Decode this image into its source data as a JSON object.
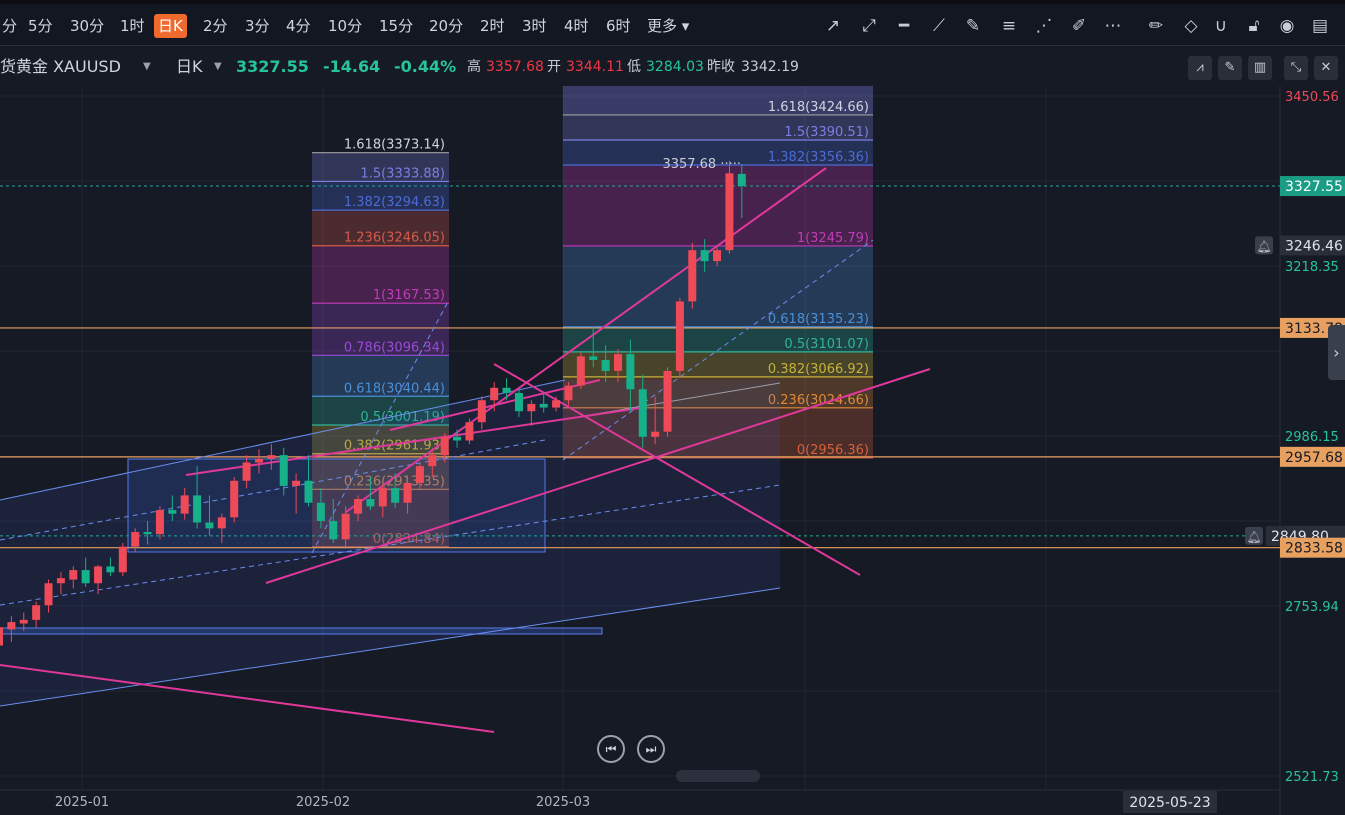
{
  "toolbar": {
    "timeframes": [
      "分",
      "5分",
      "30分",
      "1时",
      "日K",
      "2分",
      "3分",
      "4分",
      "10分",
      "15分",
      "20分",
      "2时",
      "3时",
      "4时",
      "6时",
      "更多"
    ],
    "active_timeframe": "日K"
  },
  "symbol": {
    "name": "货黄金 XAUUSD",
    "interval": "日K",
    "last": "3327.55",
    "change": "-14.64",
    "change_pct": "-0.44%",
    "high_label": "高",
    "high": "3357.68",
    "open_label": "开",
    "open": "3344.11",
    "low_label": "低",
    "low": "3284.03",
    "prev_label": "昨收",
    "prev_close": "3342.19"
  },
  "colors": {
    "up": "#f23645",
    "down": "#089981",
    "accent": "#f06a2e"
  },
  "chart_data": {
    "type": "candlestick",
    "x_ticks": [
      "2025-01",
      "2025-02",
      "2025-03"
    ],
    "crosshair_date": "2025-05-23",
    "price_axis_ticks": [
      "3450.56",
      "3218.35",
      "2986.15",
      "2753.94",
      "2521.73"
    ],
    "price_labels": [
      {
        "value": "3327.55",
        "kind": "last"
      },
      {
        "value": "3246.46",
        "kind": "alert"
      },
      {
        "value": "3133.78",
        "kind": "level"
      },
      {
        "value": "2957.68",
        "kind": "level"
      },
      {
        "value": "2849.80",
        "kind": "alert"
      },
      {
        "value": "2833.58",
        "kind": "level"
      }
    ],
    "high_marker": "3357.68",
    "fib_left": {
      "levels": [
        {
          "label": "1.618(3373.14)",
          "price": 3373.14,
          "color": "#a0a0a0"
        },
        {
          "label": "1.5(3333.88)",
          "price": 3333.88,
          "color": "#7b7fe0"
        },
        {
          "label": "1.382(3294.63)",
          "price": 3294.63,
          "color": "#4c6bd8"
        },
        {
          "label": "1.236(3246.05)",
          "price": 3246.05,
          "color": "#d65a4a"
        },
        {
          "label": "1(3167.53)",
          "price": 3167.53,
          "color": "#c43ab8"
        },
        {
          "label": "0.786(3096.34)",
          "price": 3096.34,
          "color": "#9a4ad8"
        },
        {
          "label": "0.618(3040.44)",
          "price": 3040.44,
          "color": "#4a90d8"
        },
        {
          "label": "0.5(3001.19)",
          "price": 3001.19,
          "color": "#2fb39a"
        },
        {
          "label": "0.382(2961.93)",
          "price": 2961.93,
          "color": "#c8b23a"
        },
        {
          "label": "0.236(2913.35)",
          "price": 2913.35,
          "color": "#e08a3a"
        },
        {
          "label": "0(2834.84)",
          "price": 2834.84,
          "color": "#d8613a"
        }
      ]
    },
    "fib_right": {
      "levels": [
        {
          "label": "1.618(3424.66)",
          "price": 3424.66,
          "color": "#a0a0a0"
        },
        {
          "label": "1.5(3390.51)",
          "price": 3390.51,
          "color": "#7b7fe0"
        },
        {
          "label": "1.382(3356.36)",
          "price": 3356.36,
          "color": "#4c6bd8"
        },
        {
          "label": "1(3245.79)",
          "price": 3245.79,
          "color": "#c43ab8"
        },
        {
          "label": "0.618(3135.23)",
          "price": 3135.23,
          "color": "#4a90d8"
        },
        {
          "label": "0.5(3101.07)",
          "price": 3101.07,
          "color": "#2fb39a"
        },
        {
          "label": "0.382(3066.92)",
          "price": 3066.92,
          "color": "#c8b23a"
        },
        {
          "label": "0.236(3024.66)",
          "price": 3024.66,
          "color": "#e08a3a"
        },
        {
          "label": "0(2956.36)",
          "price": 2956.36,
          "color": "#d8613a"
        }
      ]
    },
    "candles": [
      [
        2700,
        2730,
        2690,
        2725
      ],
      [
        2722,
        2740,
        2705,
        2732
      ],
      [
        2730,
        2745,
        2720,
        2735
      ],
      [
        2735,
        2760,
        2725,
        2755
      ],
      [
        2755,
        2790,
        2745,
        2785
      ],
      [
        2785,
        2800,
        2770,
        2792
      ],
      [
        2790,
        2808,
        2778,
        2803
      ],
      [
        2803,
        2820,
        2780,
        2785
      ],
      [
        2785,
        2810,
        2770,
        2808
      ],
      [
        2808,
        2820,
        2795,
        2800
      ],
      [
        2800,
        2840,
        2795,
        2835
      ],
      [
        2835,
        2860,
        2828,
        2855
      ],
      [
        2855,
        2870,
        2838,
        2852
      ],
      [
        2852,
        2890,
        2845,
        2885
      ],
      [
        2885,
        2905,
        2870,
        2880
      ],
      [
        2880,
        2915,
        2872,
        2905
      ],
      [
        2905,
        2945,
        2860,
        2868
      ],
      [
        2868,
        2905,
        2850,
        2860
      ],
      [
        2860,
        2880,
        2840,
        2875
      ],
      [
        2875,
        2930,
        2868,
        2925
      ],
      [
        2925,
        2960,
        2915,
        2950
      ],
      [
        2950,
        2968,
        2935,
        2955
      ],
      [
        2955,
        2975,
        2940,
        2960
      ],
      [
        2960,
        2970,
        2905,
        2918
      ],
      [
        2918,
        2935,
        2880,
        2925
      ],
      [
        2925,
        2960,
        2890,
        2895
      ],
      [
        2895,
        2915,
        2860,
        2870
      ],
      [
        2870,
        2900,
        2840,
        2845
      ],
      [
        2845,
        2890,
        2835,
        2880
      ],
      [
        2880,
        2905,
        2870,
        2900
      ],
      [
        2900,
        2930,
        2885,
        2890
      ],
      [
        2890,
        2920,
        2875,
        2915
      ],
      [
        2915,
        2935,
        2888,
        2895
      ],
      [
        2895,
        2930,
        2880,
        2922
      ],
      [
        2922,
        2950,
        2912,
        2945
      ],
      [
        2945,
        2965,
        2930,
        2960
      ],
      [
        2960,
        2990,
        2950,
        2985
      ],
      [
        2985,
        2995,
        2970,
        2980
      ],
      [
        2980,
        3010,
        2975,
        3005
      ],
      [
        3005,
        3040,
        2995,
        3035
      ],
      [
        3035,
        3060,
        3020,
        3052
      ],
      [
        3052,
        3065,
        3035,
        3045
      ],
      [
        3045,
        3050,
        3012,
        3020
      ],
      [
        3020,
        3035,
        3000,
        3030
      ],
      [
        3030,
        3045,
        3018,
        3025
      ],
      [
        3025,
        3040,
        3020,
        3035
      ],
      [
        3035,
        3060,
        3028,
        3055
      ],
      [
        3055,
        3100,
        3050,
        3095
      ],
      [
        3095,
        3135,
        3080,
        3090
      ],
      [
        3090,
        3110,
        3060,
        3075
      ],
      [
        3075,
        3105,
        3060,
        3098
      ],
      [
        3098,
        3118,
        3020,
        3050
      ],
      [
        3050,
        3070,
        2970,
        2985
      ],
      [
        2985,
        3040,
        2975,
        2992
      ],
      [
        2992,
        3080,
        2985,
        3075
      ],
      [
        3075,
        3175,
        3065,
        3170
      ],
      [
        3170,
        3250,
        3160,
        3240
      ],
      [
        3240,
        3255,
        3210,
        3225
      ],
      [
        3225,
        3245,
        3218,
        3240
      ],
      [
        3240,
        3362,
        3235,
        3345
      ],
      [
        3344.11,
        3357.68,
        3284.03,
        3327.55
      ]
    ],
    "drawings": "channels, trend lines and fibonacci retracements"
  }
}
